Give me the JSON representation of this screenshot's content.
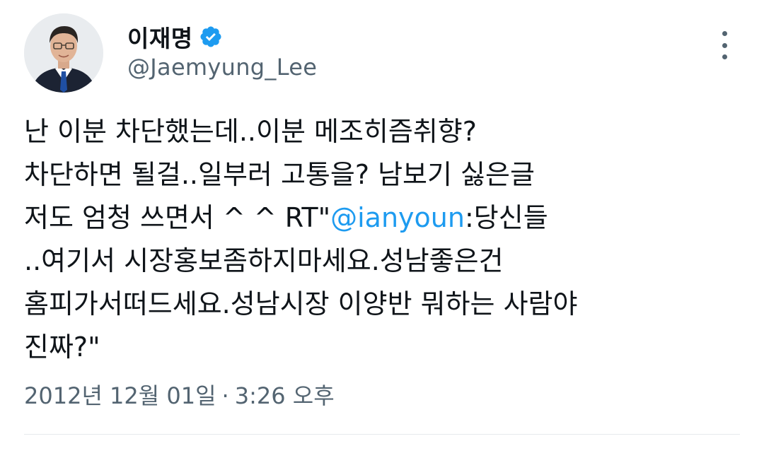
{
  "author": {
    "display_name": "이재명",
    "handle": "@Jaemyung_Lee",
    "avatar_icon": "profile-photo-avatar",
    "verified_icon": "verified-badge-icon",
    "verified_color": "#1d9bf0"
  },
  "menu": {
    "more_icon": "more-options-vertical-icon"
  },
  "tweet": {
    "line1": "난 이분 차단했는데..이분 메조히즘취향?",
    "line2": "차단하면 될걸..일부러 고통을? 남보기 싫은글",
    "line3_before": "저도 엄청 쓰면서 ^ ^ RT\"",
    "line3_mention": "@ianyoun",
    "line3_after": ":당신들",
    "line4": "..여기서 시장홍보좀하지마세요.성남좋은건",
    "line5": "홈피가서떠드세요.성남시장 이양반 뭐하는 사람야",
    "line6": "진짜?\"",
    "mention_color": "#1d9bf0"
  },
  "meta": {
    "date": "2012년 12월 01일",
    "separator": "·",
    "time": "3:26 오후"
  },
  "colors": {
    "text": "#0f1419",
    "secondary": "#536471",
    "divider": "#e6e9ec"
  }
}
